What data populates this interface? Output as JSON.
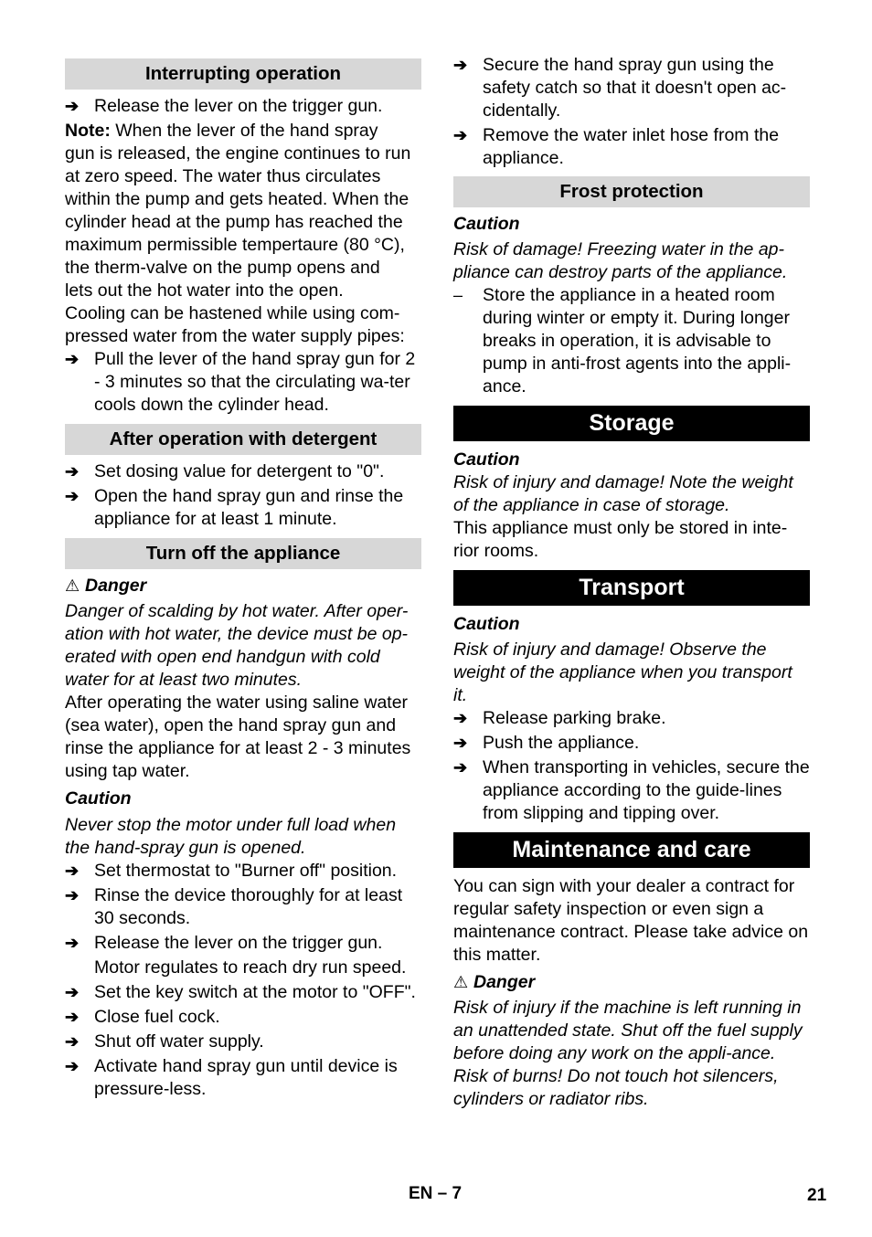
{
  "left_column": {
    "interrupting": {
      "heading": "Interrupting operation",
      "step1": "Release the lever on the trigger gun.",
      "note_label": "Note:",
      "note_lines": [
        " When the lever of the hand spray",
        "gun is released, the engine continues to run",
        "at zero speed. The water thus circulates",
        "within the pump and gets heated. When the",
        "cylinder head at the pump has reached the",
        "maximum permissible tempertaure (80 °C),",
        "the therm-valve on the pump opens and",
        "lets out the hot water into the open.",
        "Cooling can be hastened while using com-",
        "pressed water from the water supply pipes:"
      ],
      "step2": "Pull the lever of the hand spray gun for 2 - 3 minutes so that the circulating wa-ter cools down the cylinder head."
    },
    "after_detergent": {
      "heading": "After operation with detergent",
      "steps": [
        "Set dosing value for detergent to \"0\".",
        "Open the hand spray gun and rinse the appliance for at least 1 minute."
      ]
    },
    "turn_off": {
      "heading": "Turn off the appliance",
      "danger_label": "Danger",
      "danger_text": "Danger of scalding by hot water. After oper-ation with hot water, the device must be op-erated with open end handgun with cold water for at least two minutes.",
      "saline_text": "After operating the water using saline water (sea water), open the hand spray gun and rinse the appliance for at least 2 - 3 minutes using tap water.",
      "caution_label": "Caution",
      "caution_text": "Never stop the motor under full load when the hand-spray gun is opened.",
      "steps": [
        "Set thermostat to \"Burner off\" position.",
        "Rinse the device thoroughly for at least 30 seconds.",
        "Release the lever on the trigger gun."
      ],
      "motor_note": "Motor regulates to reach dry run speed.",
      "steps2": [
        "Set the key switch at the motor to \"OFF\".",
        "Close fuel cock.",
        "Shut off water supply.",
        "Activate hand spray gun until device is pressure-less."
      ]
    }
  },
  "right_column": {
    "continued_steps": [
      "Secure the hand spray gun using the safety catch so that it doesn't open ac-cidentally.",
      "Remove the water inlet hose from the appliance."
    ],
    "frost": {
      "heading": "Frost protection",
      "caution_label": "Caution",
      "caution_text": "Risk of damage! Freezing water in the ap-pliance can destroy parts of the appliance.",
      "dash_item": "Store the appliance in a heated room during winter or empty it. During longer breaks in operation, it is advisable to pump in anti-frost agents into the appli-ance."
    },
    "storage": {
      "heading": "Storage",
      "caution_label": "Caution",
      "caution_text": "Risk of injury and damage! Note the weight of the appliance in case of storage.",
      "body": "This appliance must only be stored in inte-rior rooms."
    },
    "transport": {
      "heading": "Transport",
      "caution_label": "Caution",
      "caution_text": "Risk of injury and damage! Observe the weight of the appliance when you transport it.",
      "steps": [
        "Release parking brake.",
        "Push the appliance.",
        "When transporting in vehicles, secure the appliance according to the guide-lines from slipping and tipping over."
      ]
    },
    "maintenance": {
      "heading": "Maintenance and care",
      "body": "You can sign with your dealer a contract for regular safety inspection or even sign a maintenance contract. Please take advice on this matter.",
      "danger_label": "Danger",
      "danger_text1": "Risk of injury if the machine is left running in an unattended state. Shut off the fuel supply before doing any work on the appli-ance.",
      "danger_text2": "Risk of burns! Do not touch hot silencers, cylinders or radiator ribs."
    }
  },
  "symbols": {
    "arrow": "➔",
    "dash": "–",
    "warning": "⚠"
  },
  "footer": {
    "section": "EN – 7",
    "page_number": "21"
  }
}
